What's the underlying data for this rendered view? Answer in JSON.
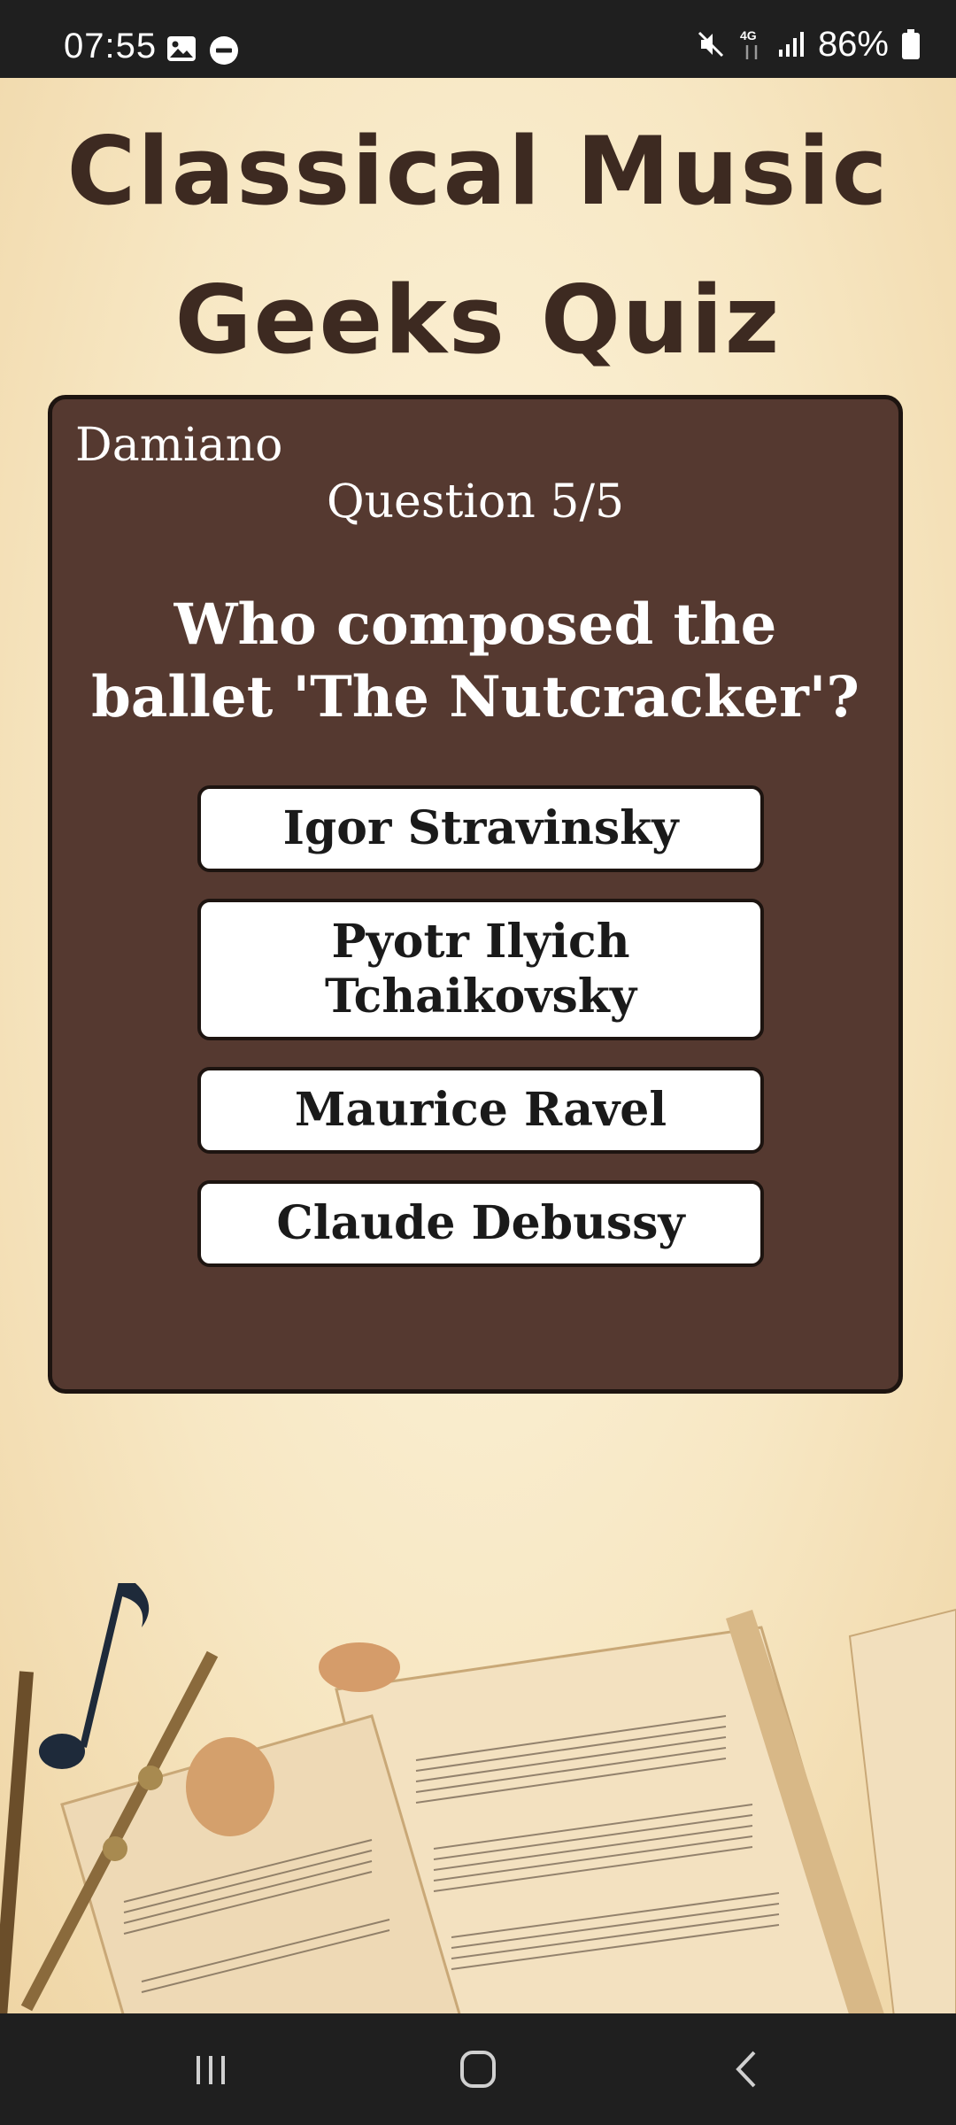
{
  "status_bar": {
    "time": "07:55",
    "battery": "86%",
    "icons": [
      "gallery-icon",
      "do-not-disturb-icon",
      "mute-icon",
      "4g-data-icon",
      "signal-icon",
      "battery-icon"
    ]
  },
  "header": {
    "title": "Classical Music Geeks Quiz"
  },
  "quiz": {
    "player_name": "Damiano",
    "question_counter": "Question 5/5",
    "question": "Who composed the ballet 'The Nutcracker'?",
    "answers": [
      {
        "label": "Igor Stravinsky"
      },
      {
        "label": "Pyotr Ilyich Tchaikovsky"
      },
      {
        "label": "Maurice Ravel"
      },
      {
        "label": "Claude Debussy"
      }
    ]
  },
  "nav_bar": {
    "icons": [
      "recent-apps-icon",
      "home-icon",
      "back-icon"
    ]
  },
  "colors": {
    "card_background": "#553930",
    "title_color": "#3d2a21",
    "page_background": "#f6e7c8",
    "system_bar": "#1f1f1f"
  }
}
